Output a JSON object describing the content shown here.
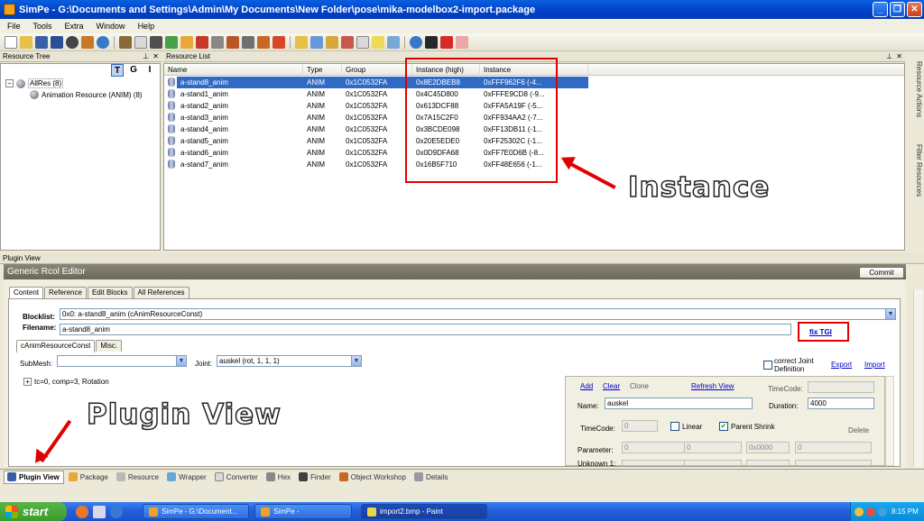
{
  "window": {
    "title": "SimPe - G:\\Documents and Settings\\Admin\\My Documents\\New Folder\\pose\\mika-modelbox2-import.package",
    "buttons": [
      "_",
      "❐",
      "✕"
    ]
  },
  "menu": [
    "File",
    "Tools",
    "Extra",
    "Window",
    "Help"
  ],
  "resource_tree": {
    "title": "Resource Tree",
    "tools": [
      "T",
      "G",
      "I"
    ],
    "root": "AllRes (8)",
    "child": "Animation Resource (ANIM) (8)"
  },
  "resource_list": {
    "title": "Resource List",
    "columns": [
      "Name",
      "Type",
      "Group",
      "Instance (high)",
      "Instance"
    ],
    "rows": [
      [
        "a-stand8_anim",
        "ANIM",
        "0x1C0532FA",
        "0x8E2DBEB8",
        "0xFFF962F6 (-4..."
      ],
      [
        "a-stand1_anim",
        "ANIM",
        "0x1C0532FA",
        "0x4C45D800",
        "0xFFFE9CD8 (-9..."
      ],
      [
        "a-stand2_anim",
        "ANIM",
        "0x1C0532FA",
        "0x613DCF88",
        "0xFFA5A19F (-5..."
      ],
      [
        "a-stand3_anim",
        "ANIM",
        "0x1C0532FA",
        "0x7A15C2F0",
        "0xFF934AA2 (-7..."
      ],
      [
        "a-stand4_anim",
        "ANIM",
        "0x1C0532FA",
        "0x3BCDE098",
        "0xFF13DB11 (-1..."
      ],
      [
        "a-stand5_anim",
        "ANIM",
        "0x1C0532FA",
        "0x20E5EDE0",
        "0xFF25302C (-1..."
      ],
      [
        "a-stand6_anim",
        "ANIM",
        "0x1C0532FA",
        "0x0D9DFA68",
        "0xFF7E0D6B (-8..."
      ],
      [
        "a-stand7_anim",
        "ANIM",
        "0x1C0532FA",
        "0x16B5F710",
        "0xFF48E656 (-1..."
      ]
    ]
  },
  "side_tabs": [
    "Resource Actions",
    "Filter Resources"
  ],
  "annotations": {
    "instance": "Instance",
    "plugin_view": "Plugin View"
  },
  "plugin_view": {
    "title": "Plugin View",
    "editor_title": "Generic Rcol Editor",
    "commit": "Commit",
    "tabs": [
      "Content",
      "Reference",
      "Edit Blocks",
      "All References"
    ],
    "blocklist_label": "Blocklist:",
    "blocklist_value": "0x0: a-stand8_anim (cAnimResourceConst)",
    "filename_label": "Filename:",
    "filename_value": "a-stand8_anim",
    "fix_tgi": "fix TGI",
    "subtabs": [
      "cAnimResourceConst",
      "Misc."
    ],
    "submesh_label": "SubMesh:",
    "joint_label": "Joint:",
    "joint_value": "auskel (rot, 1, 1, 1)",
    "correct_joint": "correct Joint Definition",
    "export": "Export",
    "import": "Import",
    "tree_item": "tc=0, comp=3, Rotation",
    "add": "Add",
    "clear": "Clear",
    "clone": "Clone",
    "refresh_view": "Refresh View",
    "timecode_label": "TimeCode:",
    "name_label": "Name:",
    "name_value": "auskel",
    "duration_label": "Duration:",
    "duration_value": "4000",
    "timecode2_label": "TimeCode:",
    "timecode2_value": "0",
    "linear": "Linear",
    "parent_shrink": "Parent Shrink",
    "delete": "Delete",
    "parameter_label": "Parameter:",
    "param_values": [
      "0",
      "0",
      "0x0000",
      "0"
    ],
    "unknown_label": "Unknown 1:"
  },
  "bottom_tabs": [
    "Plugin View",
    "Package",
    "Resource",
    "Wrapper",
    "Converter",
    "Hex",
    "Finder",
    "Object Workshop",
    "Details"
  ],
  "taskbar": {
    "start": "start",
    "tasks": [
      "SimPe - G:\\Document...",
      "SimPe -",
      "import2.bmp - Paint"
    ],
    "clock": "8:15 PM"
  }
}
